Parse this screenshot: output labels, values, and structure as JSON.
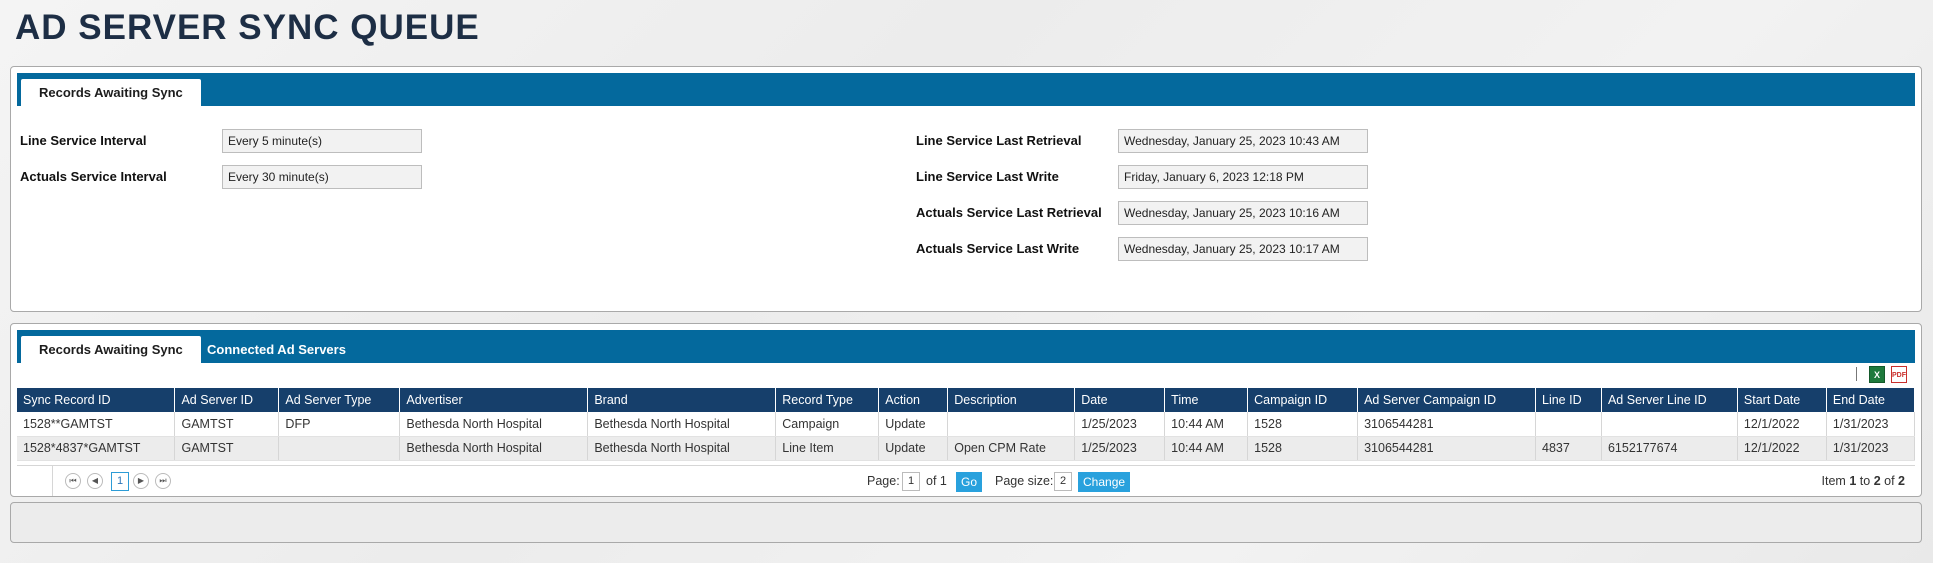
{
  "page": {
    "title": "AD SERVER SYNC QUEUE"
  },
  "top_panel": {
    "tab_label": "Records Awaiting Sync",
    "left_fields": [
      {
        "label": "Line Service Interval",
        "value": "Every 5 minute(s)"
      },
      {
        "label": "Actuals Service Interval",
        "value": "Every 30 minute(s)"
      }
    ],
    "right_fields": [
      {
        "label": "Line Service Last Retrieval",
        "value": "Wednesday, January 25, 2023 10:43 AM"
      },
      {
        "label": "Line Service Last Write",
        "value": "Friday, January 6, 2023 12:18 PM"
      },
      {
        "label": "Actuals Service Last Retrieval",
        "value": "Wednesday, January 25, 2023 10:16 AM"
      },
      {
        "label": "Actuals Service Last Write",
        "value": "Wednesday, January 25, 2023 10:17 AM"
      }
    ]
  },
  "bottom_panel": {
    "tabs": [
      "Records Awaiting Sync",
      "Connected Ad Servers"
    ],
    "export_icons": [
      "excel-icon",
      "pdf-icon"
    ],
    "columns": [
      "Sync Record ID",
      "Ad Server ID",
      "Ad Server Type",
      "Advertiser",
      "Brand",
      "Record Type",
      "Action",
      "Description",
      "Date",
      "Time",
      "Campaign ID",
      "Ad Server Campaign ID",
      "Line ID",
      "Ad Server Line ID",
      "Start Date",
      "End Date"
    ],
    "rows": [
      [
        "1528**GAMTST",
        "GAMTST",
        "DFP",
        "Bethesda North Hospital",
        "Bethesda North Hospital",
        "Campaign",
        "Update",
        "",
        "1/25/2023",
        "10:44 AM",
        "1528",
        "3106544281",
        "",
        "",
        "12/1/2022",
        "1/31/2023"
      ],
      [
        "1528*4837*GAMTST",
        "GAMTST",
        "",
        "Bethesda North Hospital",
        "Bethesda North Hospital",
        "Line Item",
        "Update",
        "Open CPM Rate",
        "1/25/2023",
        "10:44 AM",
        "1528",
        "3106544281",
        "4837",
        "6152177674",
        "12/1/2022",
        "1/31/2023"
      ]
    ],
    "pager": {
      "current_page": "1",
      "page_label": "Page:",
      "page_value": "1",
      "of_text": "of 1",
      "go_label": "Go",
      "page_size_label": "Page size:",
      "page_size_value": "2",
      "change_label": "Change",
      "item_prefix": "Item",
      "item_from": "1",
      "item_to_word": "to",
      "item_to": "2",
      "item_of_word": "of",
      "item_total": "2"
    }
  }
}
